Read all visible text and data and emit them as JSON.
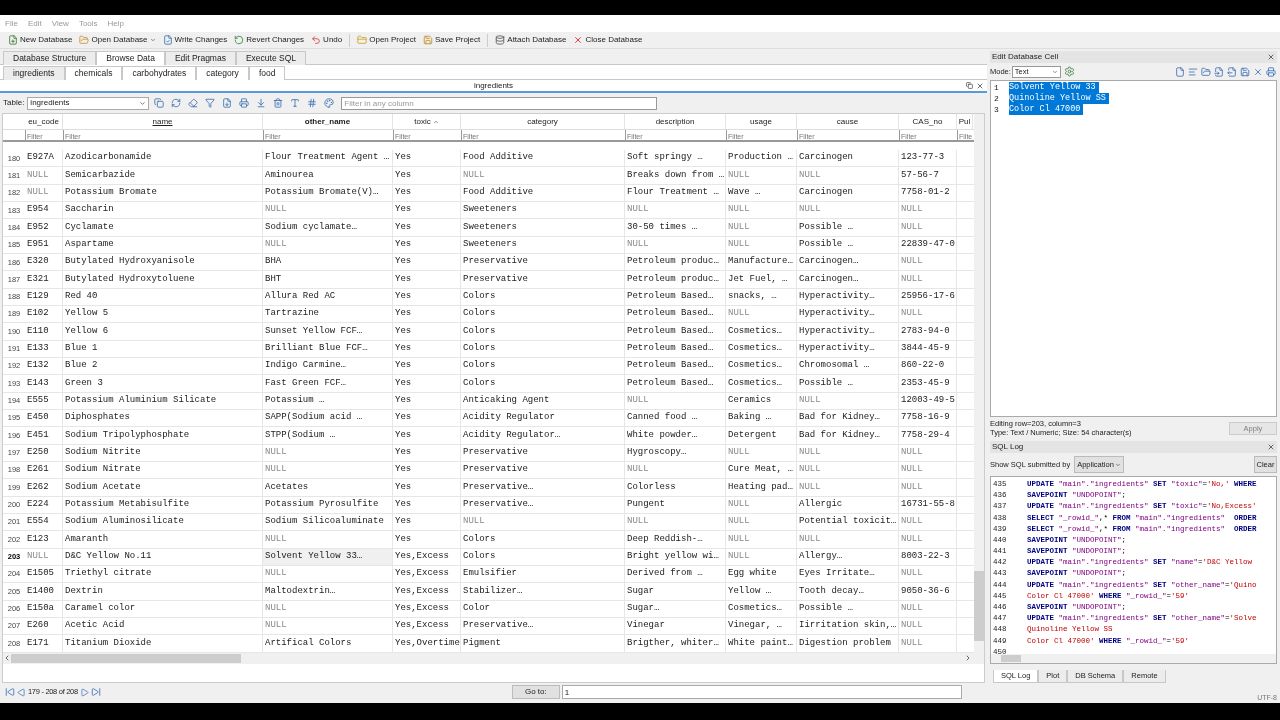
{
  "menu": [
    {
      "label": "File"
    },
    {
      "label": "Edit"
    },
    {
      "label": "View"
    },
    {
      "label": "Tools"
    },
    {
      "label": "Help"
    }
  ],
  "toolbar": [
    {
      "kind": "new",
      "label": "New Database",
      "dropdown": false
    },
    {
      "kind": "open",
      "label": "Open Database",
      "dropdown": true
    },
    {
      "kind": "write",
      "label": "Write Changes",
      "dropdown": false
    },
    {
      "kind": "revert",
      "label": "Revert Changes",
      "dropdown": false
    },
    {
      "kind": "undo",
      "label": "Undo",
      "dropdown": false
    },
    {
      "kind": "open_project",
      "label": "Open Project",
      "dropdown": false
    },
    {
      "kind": "save_project",
      "label": "Save Project",
      "dropdown": false
    },
    {
      "kind": "attach",
      "label": "Attach Database",
      "dropdown": false
    },
    {
      "kind": "close",
      "label": "Close Database",
      "dropdown": false
    }
  ],
  "main_tabs": [
    {
      "label": "Database Structure",
      "selected": false
    },
    {
      "label": "Browse Data",
      "selected": true
    },
    {
      "label": "Edit Pragmas",
      "selected": false
    },
    {
      "label": "Execute SQL",
      "selected": false
    }
  ],
  "table_tabs": [
    {
      "label": "ingredients",
      "selected": true
    },
    {
      "label": "chemicals",
      "selected": false
    },
    {
      "label": "carbohydrates",
      "selected": false
    },
    {
      "label": "category",
      "selected": false
    },
    {
      "label": "food",
      "selected": false
    }
  ],
  "panel_title": "ingredients",
  "table_select": {
    "label": "Table:",
    "value": "ingredients"
  },
  "filter_all": {
    "placeholder": "Filter in any column"
  },
  "table": {
    "columns": [
      {
        "label": "eu_code",
        "selected": false,
        "hovered": false,
        "sort_ascending": false,
        "placeholder": "Filter"
      },
      {
        "label": "name",
        "selected": false,
        "hovered": true,
        "sort_ascending": false,
        "placeholder": "Filter"
      },
      {
        "label": "other_name",
        "selected": true,
        "hovered": false,
        "sort_ascending": false,
        "placeholder": "Filter"
      },
      {
        "label": "toxic",
        "selected": false,
        "hovered": false,
        "sort_ascending": true,
        "placeholder": "Filter"
      },
      {
        "label": "category",
        "selected": false,
        "hovered": false,
        "sort_ascending": false,
        "placeholder": "Filter"
      },
      {
        "label": "description",
        "selected": false,
        "hovered": false,
        "sort_ascending": false,
        "placeholder": "Filter"
      },
      {
        "label": "usage",
        "selected": false,
        "hovered": false,
        "sort_ascending": false,
        "placeholder": "Filter"
      },
      {
        "label": "cause",
        "selected": false,
        "hovered": false,
        "sort_ascending": false,
        "placeholder": "Filter"
      },
      {
        "label": "CAS_no",
        "selected": false,
        "hovered": false,
        "sort_ascending": false,
        "placeholder": "Filter"
      },
      {
        "label": "Pul",
        "selected": false,
        "hovered": false,
        "sort_ascending": false,
        "placeholder": "Filte"
      }
    ],
    "rows": [
      {
        "num": "180",
        "selected": false,
        "cells": [
          "E927A",
          "Azodicarbonamide",
          "Flour Treatment Agent …",
          "Yes",
          "Food Additive",
          "Soft springy …",
          "Production …",
          "Carcinogen",
          "123-77-3"
        ]
      },
      {
        "num": "181",
        "selected": false,
        "cells": [
          {
            "text": "NULL",
            "is_null": true
          },
          "Semicarbazide",
          "Aminourea",
          "Yes",
          {
            "text": "NULL",
            "is_null": true
          },
          "Breaks down from …",
          {
            "text": "NULL",
            "is_null": true
          },
          {
            "text": "NULL",
            "is_null": true
          },
          "57-56-7"
        ]
      },
      {
        "num": "182",
        "selected": false,
        "cells": [
          {
            "text": "NULL",
            "is_null": true
          },
          "Potassium Bromate",
          "Potassium Bromate(V)…",
          "Yes",
          "Food Additive",
          "Flour Treatment …",
          "Wave …",
          "Carcinogen",
          "7758-01-2"
        ]
      },
      {
        "num": "183",
        "selected": false,
        "cells": [
          "E954",
          "Saccharin",
          {
            "text": "NULL",
            "is_null": true
          },
          "Yes",
          "Sweeteners",
          {
            "text": "NULL",
            "is_null": true
          },
          {
            "text": "NULL",
            "is_null": true
          },
          {
            "text": "NULL",
            "is_null": true
          },
          {
            "text": "NULL",
            "is_null": true
          }
        ]
      },
      {
        "num": "184",
        "selected": false,
        "cells": [
          "E952",
          "Cyclamate",
          "Sodium cyclamate…",
          "Yes",
          "Sweeteners",
          "30-50 times …",
          {
            "text": "NULL",
            "is_null": true
          },
          "Possible …",
          {
            "text": "NULL",
            "is_null": true
          }
        ]
      },
      {
        "num": "185",
        "selected": false,
        "cells": [
          "E951",
          "Aspartame",
          {
            "text": "NULL",
            "is_null": true
          },
          "Yes",
          "Sweeteners",
          {
            "text": "NULL",
            "is_null": true
          },
          {
            "text": "NULL",
            "is_null": true
          },
          "Possible …",
          "22839-47-0"
        ]
      },
      {
        "num": "186",
        "selected": false,
        "cells": [
          "E320",
          "Butylated Hydroxyanisole",
          "BHA",
          "Yes",
          "Preservative",
          "Petroleum produc…",
          "Manufacture…",
          "Carcinogen…",
          {
            "text": "NULL",
            "is_null": true
          }
        ]
      },
      {
        "num": "187",
        "selected": false,
        "cells": [
          "E321",
          "Butylated Hydroxytoluene",
          "BHT",
          "Yes",
          "Preservative",
          "Petroleum produc…",
          "Jet Fuel, …",
          "Carcinogen…",
          {
            "text": "NULL",
            "is_null": true
          }
        ]
      },
      {
        "num": "188",
        "selected": false,
        "cells": [
          "E129",
          "Red 40",
          "Allura Red AC",
          "Yes",
          "Colors",
          "Petroleum Based…",
          "snacks, …",
          "Hyperactivity…",
          "25956-17-6"
        ]
      },
      {
        "num": "189",
        "selected": false,
        "cells": [
          "E102",
          "Yellow 5",
          "Tartrazine",
          "Yes",
          "Colors",
          "Petroleum Based…",
          {
            "text": "NULL",
            "is_null": true
          },
          "Hyperactivity…",
          {
            "text": "NULL",
            "is_null": true
          }
        ]
      },
      {
        "num": "190",
        "selected": false,
        "cells": [
          "E110",
          "Yellow 6",
          "Sunset Yellow FCF…",
          "Yes",
          "Colors",
          "Petroleum Based…",
          "Cosmetics…",
          "Hyperactivity…",
          "2783-94-0"
        ]
      },
      {
        "num": "191",
        "selected": false,
        "cells": [
          "E133",
          "Blue 1",
          "Brilliant Blue FCF…",
          "Yes",
          "Colors",
          "Petroleum Based…",
          "Cosmetics…",
          "Hyperactivity…",
          "3844-45-9"
        ]
      },
      {
        "num": "192",
        "selected": false,
        "cells": [
          "E132",
          "Blue 2",
          "Indigo Carmine…",
          "Yes",
          "Colors",
          "Petroleum Based…",
          "Cosmetics…",
          "Chromosomal …",
          "860-22-0"
        ]
      },
      {
        "num": "193",
        "selected": false,
        "cells": [
          "E143",
          "Green 3",
          "Fast Green FCF…",
          "Yes",
          "Colors",
          "Petroleum Based…",
          "Cosmetics…",
          "Possible …",
          "2353-45-9"
        ]
      },
      {
        "num": "194",
        "selected": false,
        "cells": [
          "E555",
          "Potassium Aluminium Silicate",
          "Potassium …",
          "Yes",
          "Anticaking Agent",
          {
            "text": "NULL",
            "is_null": true
          },
          "Ceramics",
          {
            "text": "NULL",
            "is_null": true
          },
          "12003-49-5"
        ]
      },
      {
        "num": "195",
        "selected": false,
        "cells": [
          "E450",
          "Diphosphates",
          "SAPP(Sodium acid …",
          "Yes",
          "Acidity Regulator",
          "Canned food …",
          "Baking …",
          "Bad for Kidney…",
          "7758-16-9"
        ]
      },
      {
        "num": "196",
        "selected": false,
        "cells": [
          "E451",
          "Sodium Tripolyphosphate",
          "STPP(Sodium …",
          "Yes",
          "Acidity Regulator…",
          "White powder…",
          "Detergent",
          "Bad for Kidney…",
          "7758-29-4"
        ]
      },
      {
        "num": "197",
        "selected": false,
        "cells": [
          "E250",
          "Sodium Nitrite",
          {
            "text": "NULL",
            "is_null": true
          },
          "Yes",
          "Preservative",
          "Hygroscopy…",
          {
            "text": "NULL",
            "is_null": true
          },
          {
            "text": "NULL",
            "is_null": true
          },
          {
            "text": "NULL",
            "is_null": true
          }
        ]
      },
      {
        "num": "198",
        "selected": false,
        "cells": [
          "E261",
          "Sodium Nitrate",
          {
            "text": "NULL",
            "is_null": true
          },
          "Yes",
          "Preservative",
          {
            "text": "NULL",
            "is_null": true
          },
          "Cure Meat, …",
          {
            "text": "NULL",
            "is_null": true
          },
          {
            "text": "NULL",
            "is_null": true
          }
        ]
      },
      {
        "num": "199",
        "selected": false,
        "cells": [
          "E262",
          "Sodium Acetate",
          "Acetates",
          "Yes",
          "Preservative…",
          "Colorless",
          "Heating pad…",
          {
            "text": "NULL",
            "is_null": true
          },
          {
            "text": "NULL",
            "is_null": true
          }
        ]
      },
      {
        "num": "200",
        "selected": false,
        "cells": [
          "E224",
          "Potassium Metabisulfite",
          "Potassium Pyrosulfite",
          "Yes",
          "Preservative…",
          "Pungent",
          {
            "text": "NULL",
            "is_null": true
          },
          "Allergic",
          "16731-55-8"
        ]
      },
      {
        "num": "201",
        "selected": false,
        "cells": [
          "E554",
          "Sodium Aluminosilicate",
          "Sodium Silicoaluminate",
          "Yes",
          {
            "text": "NULL",
            "is_null": true
          },
          {
            "text": "NULL",
            "is_null": true
          },
          {
            "text": "NULL",
            "is_null": true
          },
          "Potential toxicit…",
          {
            "text": "NULL",
            "is_null": true
          }
        ]
      },
      {
        "num": "202",
        "selected": false,
        "cells": [
          "E123",
          "Amaranth",
          {
            "text": "NULL",
            "is_null": true
          },
          "Yes",
          "Colors",
          "Deep Reddish-…",
          {
            "text": "NULL",
            "is_null": true
          },
          {
            "text": "NULL",
            "is_null": true
          },
          {
            "text": "NULL",
            "is_null": true
          }
        ]
      },
      {
        "num": "203",
        "selected": true,
        "cells": [
          {
            "text": "NULL",
            "is_null": true
          },
          "D&C Yellow No.11",
          "Solvent Yellow 33…",
          "Yes,Excess",
          "Colors",
          "Bright yellow wi…",
          {
            "text": "NULL",
            "is_null": true
          },
          "Allergy…",
          "8003-22-3"
        ]
      },
      {
        "num": "204",
        "selected": false,
        "cells": [
          "E1505",
          "Triethyl citrate",
          {
            "text": "NULL",
            "is_null": true
          },
          "Yes,Excess",
          "Emulsifier",
          "Derived from …",
          "Egg white",
          "Eyes Irritate…",
          {
            "text": "NULL",
            "is_null": true
          }
        ]
      },
      {
        "num": "205",
        "selected": false,
        "cells": [
          "E1400",
          "Dextrin",
          "Maltodextrin…",
          "Yes,Excess",
          "Stabilizer…",
          "Sugar",
          "Yellow …",
          "Tooth decay…",
          "9050-36-6"
        ]
      },
      {
        "num": "206",
        "selected": false,
        "cells": [
          "E150a",
          "Caramel color",
          {
            "text": "NULL",
            "is_null": true
          },
          "Yes,Excess",
          "Color",
          "Sugar…",
          "Cosmetics…",
          "Possible …",
          {
            "text": "NULL",
            "is_null": true
          }
        ]
      },
      {
        "num": "207",
        "selected": false,
        "cells": [
          "E260",
          "Acetic Acid",
          {
            "text": "NULL",
            "is_null": true
          },
          "Yes,Excess",
          "Preservative…",
          "Vinegar",
          "Vinegar, …",
          "Iirritation skin,…",
          {
            "text": "NULL",
            "is_null": true
          }
        ]
      },
      {
        "num": "208",
        "selected": false,
        "cells": [
          "E171",
          "Titanium Dioxide",
          "Artifical Colors",
          "Yes,Overtime",
          "Pigment",
          "Brigther, whiter…",
          "White paint…",
          "Digestion problem",
          {
            "text": "NULL",
            "is_null": true
          }
        ]
      }
    ]
  },
  "pager": {
    "range": "179 - 208 of 208",
    "goto_label": "Go to:",
    "goto_value": "1"
  },
  "edit_cell": {
    "title": "Edit Database Cell",
    "mode_label": "Mode:",
    "mode": "Text",
    "lines": [
      {
        "num": "1",
        "text": "Solvent Yellow 33",
        "selected": true
      },
      {
        "num": "2",
        "text": "Quinoline Yellow SS",
        "selected": true
      },
      {
        "num": "3",
        "text": "Color Cl 47000",
        "selected": true
      }
    ],
    "status_1": "Editing row=203, column=3",
    "status_2": "Type: Text / Numeric; Size: 54 character(s)",
    "apply": {
      "label": "Apply",
      "disabled": true
    }
  },
  "sql_log": {
    "title": "SQL Log",
    "submitted_label": "Show SQL submitted by",
    "submitted_value": "Application",
    "clear": "Clear",
    "lines": [
      {
        "num": "435",
        "parts": [
          {
            "kind": "keyword",
            "text": "UPDATE"
          },
          {
            "kind": "ident",
            "text": " \"main\".\"ingredients\" "
          },
          {
            "kind": "keyword",
            "text": "SET"
          },
          {
            "kind": "ident",
            "text": " \"toxic\""
          },
          {
            "kind": "plain",
            "text": "="
          },
          {
            "kind": "string",
            "text": "'No,'"
          },
          {
            "kind": "keyword",
            "text": " WHERE"
          }
        ]
      },
      {
        "num": "436",
        "parts": [
          {
            "kind": "keyword",
            "text": "SAVEPOINT"
          },
          {
            "kind": "ident",
            "text": " \"UNDOPOINT\""
          },
          {
            "kind": "plain",
            "text": ";"
          }
        ]
      },
      {
        "num": "437",
        "parts": [
          {
            "kind": "keyword",
            "text": "UPDATE"
          },
          {
            "kind": "ident",
            "text": " \"main\".\"ingredients\" "
          },
          {
            "kind": "keyword",
            "text": "SET"
          },
          {
            "kind": "ident",
            "text": " \"toxic\""
          },
          {
            "kind": "plain",
            "text": "="
          },
          {
            "kind": "string",
            "text": "'No,Excess'"
          }
        ]
      },
      {
        "num": "438",
        "parts": [
          {
            "kind": "keyword",
            "text": "SELECT"
          },
          {
            "kind": "ident",
            "text": " \"_rowid_\""
          },
          {
            "kind": "plain",
            "text": ",* "
          },
          {
            "kind": "keyword",
            "text": "FROM"
          },
          {
            "kind": "ident",
            "text": " \"main\".\"ingredients\"  "
          },
          {
            "kind": "keyword",
            "text": "ORDER"
          }
        ]
      },
      {
        "num": "439",
        "parts": [
          {
            "kind": "keyword",
            "text": "SELECT"
          },
          {
            "kind": "ident",
            "text": " \"_rowid_\""
          },
          {
            "kind": "plain",
            "text": ",* "
          },
          {
            "kind": "keyword",
            "text": "FROM"
          },
          {
            "kind": "ident",
            "text": " \"main\".\"ingredients\"  "
          },
          {
            "kind": "keyword",
            "text": "ORDER"
          }
        ]
      },
      {
        "num": "440",
        "parts": [
          {
            "kind": "keyword",
            "text": "SAVEPOINT"
          },
          {
            "kind": "ident",
            "text": " \"UNDOPOINT\""
          },
          {
            "kind": "plain",
            "text": ";"
          }
        ]
      },
      {
        "num": "441",
        "parts": [
          {
            "kind": "keyword",
            "text": "SAVEPOINT"
          },
          {
            "kind": "ident",
            "text": " \"UNDOPOINT\""
          },
          {
            "kind": "plain",
            "text": ";"
          }
        ]
      },
      {
        "num": "442",
        "parts": [
          {
            "kind": "keyword",
            "text": "UPDATE"
          },
          {
            "kind": "ident",
            "text": " \"main\".\"ingredients\" "
          },
          {
            "kind": "keyword",
            "text": "SET"
          },
          {
            "kind": "ident",
            "text": " \"name\""
          },
          {
            "kind": "plain",
            "text": "="
          },
          {
            "kind": "string",
            "text": "'D&C Yellow"
          }
        ]
      },
      {
        "num": "443",
        "parts": [
          {
            "kind": "keyword",
            "text": "SAVEPOINT"
          },
          {
            "kind": "ident",
            "text": " \"UNDOPOINT\""
          },
          {
            "kind": "plain",
            "text": ";"
          }
        ]
      },
      {
        "num": "444",
        "parts": [
          {
            "kind": "keyword",
            "text": "UPDATE"
          },
          {
            "kind": "ident",
            "text": " \"main\".\"ingredients\" "
          },
          {
            "kind": "keyword",
            "text": "SET"
          },
          {
            "kind": "ident",
            "text": " \"other_name\""
          },
          {
            "kind": "plain",
            "text": "="
          },
          {
            "kind": "string",
            "text": "'Quino"
          }
        ]
      },
      {
        "num": "445",
        "parts": [
          {
            "kind": "string",
            "text": "Color Cl 47000'"
          },
          {
            "kind": "keyword",
            "text": " WHERE"
          },
          {
            "kind": "ident",
            "text": " \"_rowid_\""
          },
          {
            "kind": "plain",
            "text": "="
          },
          {
            "kind": "string",
            "text": "'59'"
          }
        ]
      },
      {
        "num": "446",
        "parts": [
          {
            "kind": "keyword",
            "text": "SAVEPOINT"
          },
          {
            "kind": "ident",
            "text": " \"UNDOPOINT\""
          },
          {
            "kind": "plain",
            "text": ";"
          }
        ]
      },
      {
        "num": "447",
        "parts": [
          {
            "kind": "keyword",
            "text": "UPDATE"
          },
          {
            "kind": "ident",
            "text": " \"main\".\"ingredients\" "
          },
          {
            "kind": "keyword",
            "text": "SET"
          },
          {
            "kind": "ident",
            "text": " \"other_name\""
          },
          {
            "kind": "plain",
            "text": "="
          },
          {
            "kind": "string",
            "text": "'Solve"
          }
        ]
      },
      {
        "num": "448",
        "parts": [
          {
            "kind": "string",
            "text": "Quinoline Yellow SS"
          }
        ]
      },
      {
        "num": "449",
        "parts": [
          {
            "kind": "string",
            "text": "Color Cl 47000'"
          },
          {
            "kind": "keyword",
            "text": " WHERE"
          },
          {
            "kind": "ident",
            "text": " \"_rowid_\""
          },
          {
            "kind": "plain",
            "text": "="
          },
          {
            "kind": "string",
            "text": "'59'"
          }
        ]
      },
      {
        "num": "450"
      }
    ]
  },
  "bottom_tabs": [
    {
      "label": "SQL Log",
      "selected": true
    },
    {
      "label": "Plot",
      "selected": false
    },
    {
      "label": "DB Schema",
      "selected": false
    },
    {
      "label": "Remote",
      "selected": false
    }
  ],
  "encoding": "UTF-8"
}
